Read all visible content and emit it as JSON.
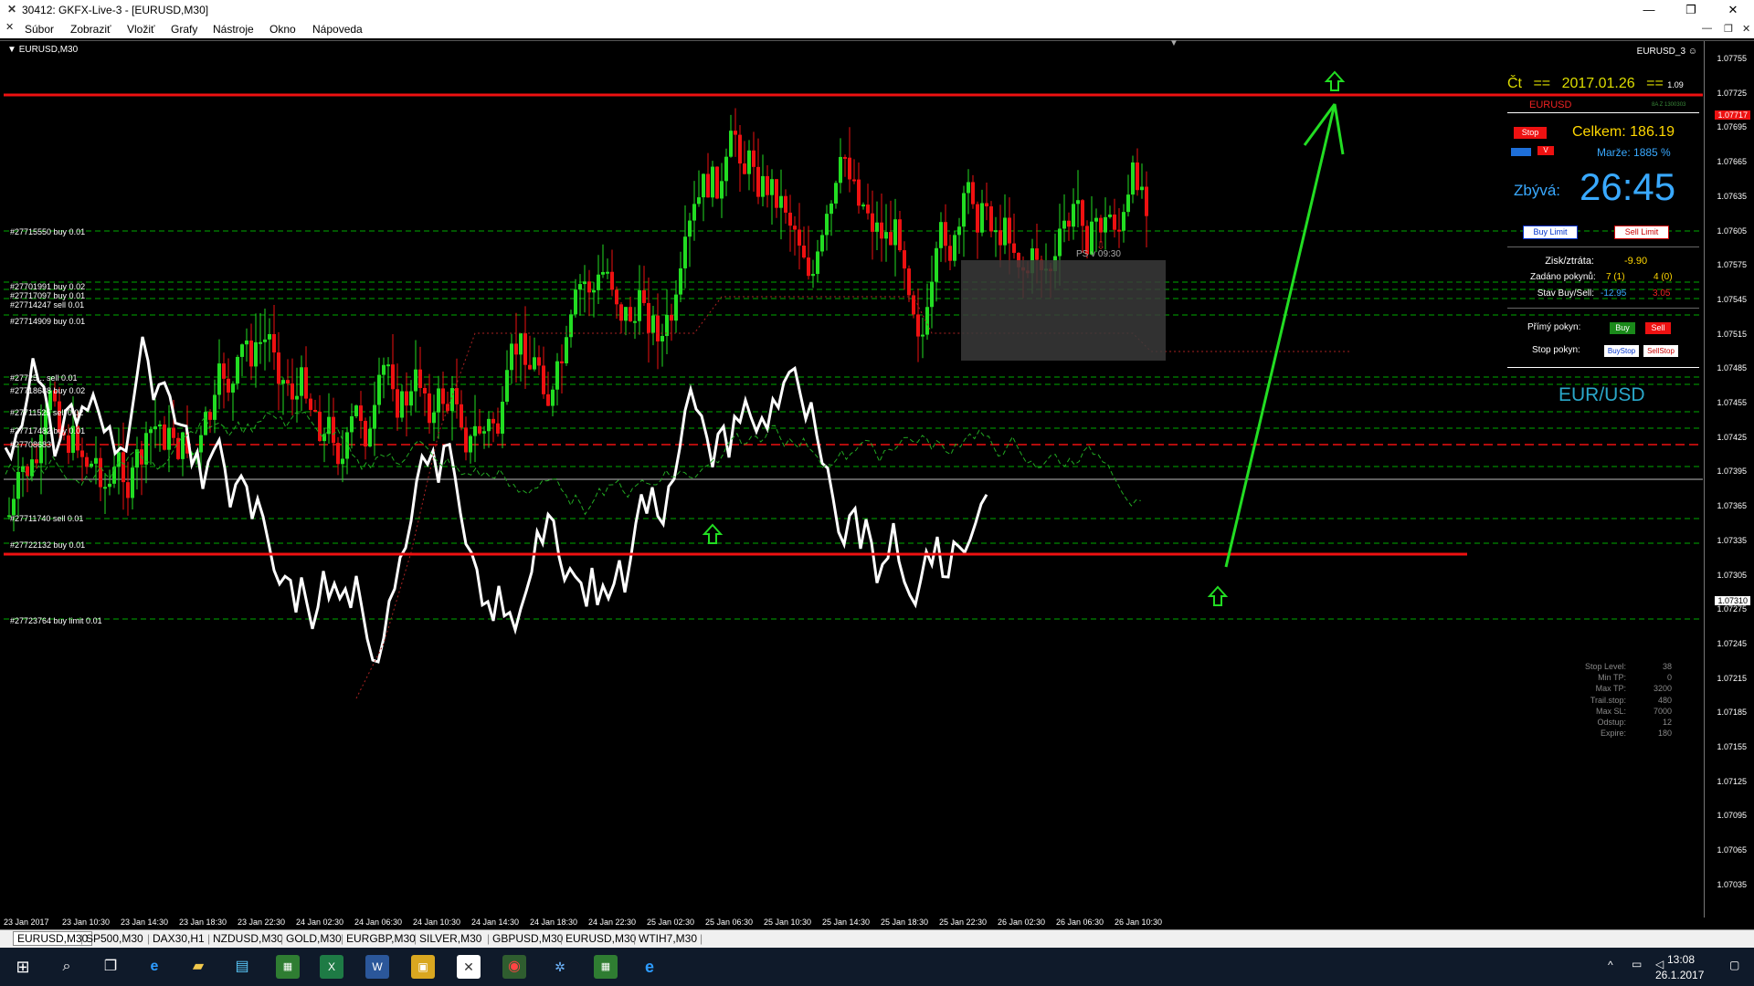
{
  "window": {
    "title": "30412: GKFX-Live-3 - [EURUSD,M30]"
  },
  "menu": {
    "items": [
      "Súbor",
      "Zobraziť",
      "Vložiť",
      "Grafy",
      "Nástroje",
      "Okno",
      "Nápoveda"
    ]
  },
  "chart": {
    "label": "EURUSD,M30",
    "ea_label": "EURUSD_3 ☺",
    "annotation": "PS v 09:30",
    "price_ticks": [
      "1.07755",
      "1.07725",
      "1.07695",
      "1.07665",
      "1.07635",
      "1.07605",
      "1.07575",
      "1.07545",
      "1.07515",
      "1.07485",
      "1.07455",
      "1.07425",
      "1.07395",
      "1.07365",
      "1.07335",
      "1.07305",
      "1.07275",
      "1.07245",
      "1.07215",
      "1.07185",
      "1.07155",
      "1.07125",
      "1.07095",
      "1.07065",
      "1.07035"
    ],
    "current_price": "1.07310",
    "resistance_price": "1.07717",
    "time_labels": [
      "23 Jan 2017",
      "23 Jan 10:30",
      "23 Jan 14:30",
      "23 Jan 18:30",
      "23 Jan 22:30",
      "24 Jan 02:30",
      "24 Jan 06:30",
      "24 Jan 10:30",
      "24 Jan 14:30",
      "24 Jan 18:30",
      "24 Jan 22:30",
      "25 Jan 02:30",
      "25 Jan 06:30",
      "25 Jan 10:30",
      "25 Jan 14:30",
      "25 Jan 18:30",
      "25 Jan 22:30",
      "26 Jan 02:30",
      "26 Jan 06:30",
      "26 Jan 10:30"
    ],
    "order_labels": [
      "#27715550 buy 0.01",
      "#27701991 buy 0.02",
      "#27717097 buy 0.01",
      "#27714247 sell 0.01",
      "#27714909 buy 0.01",
      "#27725... sell 0.01",
      "#27718688 buy 0.02",
      "#27711525 sell 0.02",
      "#27717482 buy 0.01",
      "#27708683",
      "#27711740 sell 0.01",
      "#27722132 buy 0.01",
      "#27723764 buy limit 0.01"
    ],
    "colors": {
      "bull": "#22dd22",
      "bear": "#ee1111",
      "line": "#ffffff",
      "level": "#ee1111",
      "grid": "#00aa00"
    }
  },
  "panel": {
    "day": "Čt",
    "sep1": "==",
    "date": "2017.01.26",
    "sep2": "==",
    "version": "1.09",
    "symbol_small": "EURUSD",
    "tiny_id": "8A Z 1300303",
    "stop_button": "Stop",
    "small_v": "V",
    "total_label": "Celkem:",
    "total_value": "186.19",
    "margin_label": "Marže:",
    "margin_value": "1885 %",
    "remaining_label": "Zbývá:",
    "remaining_value": "26:45",
    "buy_limit": "Buy Limit",
    "sell_limit": "Sell Limit",
    "pl_label": "Zisk/ztráta:",
    "pl_value": "-9.90",
    "orders_label": "Zadáno pokynů:",
    "orders_buy": "7 (1)",
    "orders_sell": "4 (0)",
    "state_label": "Stav Buy/Sell:",
    "state_buy": "-12.95",
    "state_sell": "3.05",
    "direct_label": "Přímý pokyn:",
    "buy": "Buy",
    "sell": "Sell",
    "stop_order_label": "Stop pokyn:",
    "buy_stop": "BuyStop",
    "sell_stop": "SellStop",
    "pair": "EUR/USD",
    "info_labels": [
      "Stop Level:",
      "Min TP:",
      "Max TP:",
      "Trail.stop:",
      "Max SL:",
      "Odstup:",
      "Expire:"
    ],
    "info_values": [
      "38",
      "0",
      "3200",
      "480",
      "7000",
      "12",
      "180"
    ]
  },
  "tabs": [
    "EURUSD,M30",
    "SP500,M30",
    "DAX30,H1",
    "NZDUSD,M30",
    "GOLD,M30",
    "EURGBP,M30",
    "SILVER,M30",
    "GBPUSD,M30",
    "EURUSD,M30",
    "WTIH7,M30"
  ],
  "taskbar": {
    "time": "13:08",
    "date": "26.1.2017"
  }
}
